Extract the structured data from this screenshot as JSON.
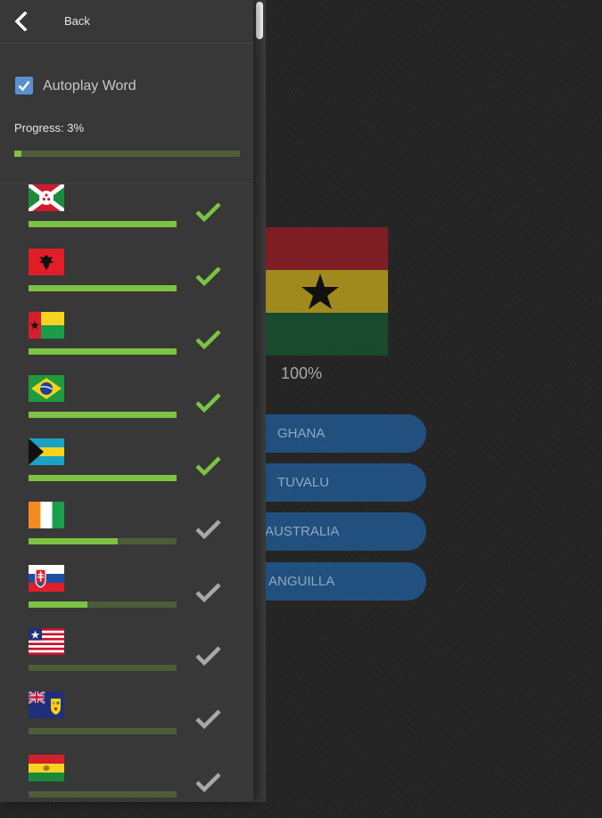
{
  "header": {
    "back_label": "Back"
  },
  "settings": {
    "autoplay_label": "Autoplay Word",
    "autoplay_checked": true
  },
  "progress": {
    "label": "Progress: 3%",
    "value": 0.03
  },
  "quiz": {
    "flag": "ghana-flag",
    "percent": "100%",
    "answers": [
      "GHANA",
      "TUVALU",
      "AUSTRALIA",
      "ANGUILLA"
    ]
  },
  "flags": [
    {
      "country": "burundi-flag",
      "progress": 1.0,
      "completed": true
    },
    {
      "country": "albania-flag",
      "progress": 1.0,
      "completed": true
    },
    {
      "country": "guinea-bissau-flag",
      "progress": 1.0,
      "completed": true
    },
    {
      "country": "brazil-flag",
      "progress": 1.0,
      "completed": true
    },
    {
      "country": "bahamas-flag",
      "progress": 1.0,
      "completed": true
    },
    {
      "country": "ivory-coast-flag",
      "progress": 0.6,
      "completed": false
    },
    {
      "country": "slovakia-flag",
      "progress": 0.4,
      "completed": false
    },
    {
      "country": "liberia-flag",
      "progress": 0.0,
      "completed": false
    },
    {
      "country": "turks-and-caicos-flag",
      "progress": 0.0,
      "completed": false
    },
    {
      "country": "bolivia-flag",
      "progress": 0.0,
      "completed": false
    }
  ],
  "colors": {
    "drawer_bg": "#383838",
    "progress_fill": "#7dc243",
    "progress_track": "#4e5c39",
    "check_done": "#7dc243",
    "check_pending": "#a8a8a8",
    "answer_bg": "#21507f",
    "checkbox": "#5b8fd4"
  }
}
